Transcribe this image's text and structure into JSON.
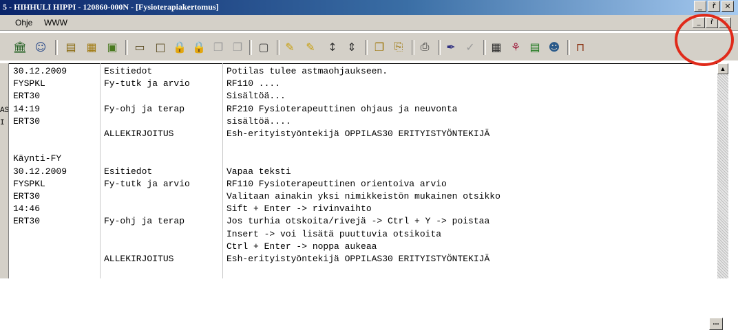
{
  "window": {
    "title": "5 - HIHHULI HIPPI - 120860-000N - [Fysioterapiakertomus]",
    "controls": [
      "_",
      "ř",
      "×"
    ]
  },
  "menubar": {
    "items": [
      "Ohje",
      "WWW"
    ],
    "mdi_controls": [
      "_",
      "ř",
      "×"
    ]
  },
  "toolbar": {
    "icons": [
      "building-icon",
      "person-icon",
      "book-icon",
      "table-icon",
      "folder-icon",
      "page-icon",
      "document-icon",
      "lock-icon",
      "lock-disabled-icon",
      "copy-icon",
      "paste-icon",
      "form-icon",
      "highlight-icon",
      "highlight-arrow-icon",
      "insert-row-icon",
      "delete-row-icon",
      "copy2-icon",
      "clipboard-icon",
      "print-icon",
      "pen-icon",
      "check-icon",
      "calculator-icon",
      "plant-icon",
      "table-green-icon",
      "person-book-icon",
      "exit-icon"
    ]
  },
  "gutter": {
    "labels": [
      "AS",
      "I"
    ]
  },
  "records": [
    {
      "c1": "30.12.2009",
      "c2": "Esitiedot",
      "c3": "Potilas tulee astmaohjaukseen."
    },
    {
      "c1": "FYSPKL",
      "c2": "Fy-tutk ja arvio",
      "c3": "RF110 ...."
    },
    {
      "c1": "ERT30",
      "c2": "",
      "c3": "Sisältöä..."
    },
    {
      "c1": "14:19",
      "c2": "Fy-ohj ja terap",
      "c3": "RF210 Fysioterapeuttinen ohjaus ja neuvonta"
    },
    {
      "c1": "ERT30",
      "c2": "",
      "c3": "sisältöä...."
    },
    {
      "c1": "",
      "c2": "ALLEKIRJOITUS",
      "c3": "Esh-erityistyöntekijä OPPILAS30 ERITYISTYÖNTEKIJÄ"
    },
    {
      "c1": "",
      "c2": "",
      "c3": ""
    },
    {
      "c1": "Käynti-FY",
      "c2": "",
      "c3": ""
    },
    {
      "c1": "30.12.2009",
      "c2": "Esitiedot",
      "c3": "Vapaa teksti"
    },
    {
      "c1": "FYSPKL",
      "c2": "Fy-tutk ja arvio",
      "c3": "RF110 Fysioterapeuttinen orientoiva arvio"
    },
    {
      "c1": "ERT30",
      "c2": "",
      "c3": "Valitaan ainakin yksi nimikkeistön mukainen otsikko"
    },
    {
      "c1": "14:46",
      "c2": "",
      "c3": "Sift + Enter -> rivinvaihto"
    },
    {
      "c1": "ERT30",
      "c2": "Fy-ohj ja terap",
      "c3": "Jos turhia otskoita/rivejä -> Ctrl + Y -> poistaa"
    },
    {
      "c1": "",
      "c2": "",
      "c3": "Insert -> voi lisätä puuttuvia otsikoita"
    },
    {
      "c1": "",
      "c2": "",
      "c3": "Ctrl + Enter -> noppa aukeaa"
    },
    {
      "c1": "",
      "c2": "ALLEKIRJOITUS",
      "c3": "Esh-erityistyöntekijä OPPILAS30 ERITYISTYÖNTEKIJÄ"
    }
  ],
  "ellipsis_button": "...",
  "colors": {
    "annotation_circle": "#e02a1a",
    "titlebar": "#0a246a",
    "chrome": "#d4d0c8"
  }
}
